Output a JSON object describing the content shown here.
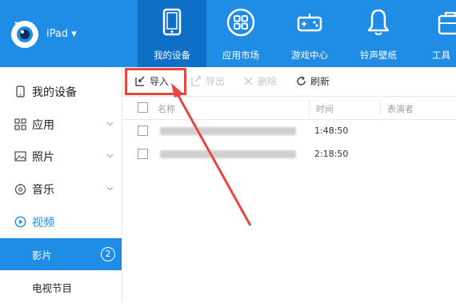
{
  "header": {
    "device_name": "iPad ▾",
    "tabs": [
      {
        "label": "我的设备",
        "icon": "tablet-icon",
        "active": true
      },
      {
        "label": "应用市场",
        "icon": "apps-grid-icon",
        "active": false
      },
      {
        "label": "游戏中心",
        "icon": "gamepad-icon",
        "active": false
      },
      {
        "label": "铃声壁纸",
        "icon": "bell-icon",
        "active": false
      },
      {
        "label": "工具",
        "icon": "toolbox-icon",
        "active": false
      }
    ]
  },
  "sidebar": {
    "items": [
      {
        "label": "我的设备",
        "icon": "device-icon",
        "expandable": false
      },
      {
        "label": "应用",
        "icon": "apps-icon",
        "expandable": true
      },
      {
        "label": "照片",
        "icon": "photo-icon",
        "expandable": true
      },
      {
        "label": "音乐",
        "icon": "music-icon",
        "expandable": true
      },
      {
        "label": "视频",
        "icon": "video-icon",
        "expandable": false
      }
    ],
    "subitems": [
      {
        "label": "影片",
        "badge": "2",
        "active": true
      },
      {
        "label": "电视节目",
        "active": false
      }
    ]
  },
  "toolbar": {
    "import_label": "导入",
    "export_label": "导出",
    "delete_label": "删除",
    "refresh_label": "刷新"
  },
  "table": {
    "headers": {
      "name": "名称",
      "time": "时间",
      "artist": "表演者"
    },
    "rows": [
      {
        "time": "1:48:50"
      },
      {
        "time": "2:18:50"
      }
    ]
  },
  "colors": {
    "header_blue": "#1f8ce6",
    "active_tab_blue": "#0f6fc6",
    "highlight_red": "#e8473d"
  }
}
